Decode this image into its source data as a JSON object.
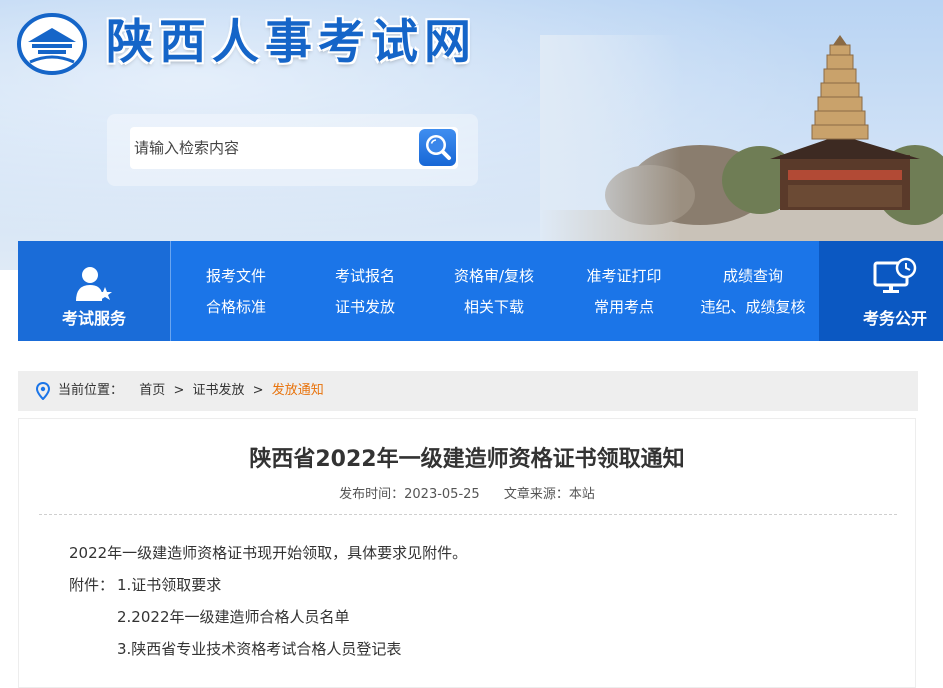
{
  "site": {
    "title": "陕西人事考试网"
  },
  "search": {
    "placeholder": "请输入检索内容"
  },
  "nav": {
    "service_label": "考试服务",
    "exam_public_label": "考务公开",
    "links": [
      {
        "label": "报考文件"
      },
      {
        "label": "考试报名"
      },
      {
        "label": "资格审/复核"
      },
      {
        "label": "准考证打印"
      },
      {
        "label": "成绩查询"
      },
      {
        "label": "合格标准"
      },
      {
        "label": "证书发放"
      },
      {
        "label": "相关下载"
      },
      {
        "label": "常用考点"
      },
      {
        "label": "违纪、成绩复核"
      }
    ]
  },
  "breadcrumb": {
    "prefix": "当前位置：",
    "items": [
      "首页",
      "证书发放",
      "发放通知"
    ],
    "separator": ">"
  },
  "article": {
    "title": "陕西省2022年一级建造师资格证书领取通知",
    "publish_label": "发布时间：",
    "publish_date": "2023-05-25",
    "source_label": "文章来源：",
    "source": "本站",
    "intro": "2022年一级建造师资格证书现开始领取，具体要求见附件。",
    "attachments_label": "附件：",
    "attachments": [
      "1.证书领取要求",
      "2.2022年一级建造师合格人员名单",
      "3.陕西省专业技术资格考试合格人员登记表"
    ]
  },
  "colors": {
    "brand_blue": "#1b75e8",
    "title_blue": "#1565c8",
    "breadcrumb_current": "#e8730c"
  }
}
